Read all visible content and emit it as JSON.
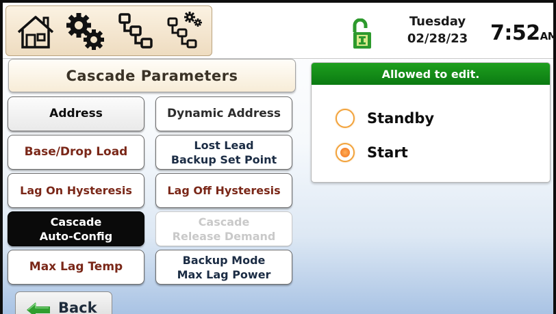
{
  "header": {
    "nav_icons": [
      "home-icon",
      "settings-gears-icon",
      "network-icon",
      "network-settings-icon"
    ],
    "lock_icon": "unlocked-padlock-icon",
    "day": "Tuesday",
    "date": "02/28/23",
    "time": "7:52",
    "ampm": "AM"
  },
  "title": "Cascade Parameters",
  "buttons": {
    "address": "Address",
    "dynamic_address": "Dynamic Address",
    "base_drop_load": "Base/Drop Load",
    "lost_lead_line1": "Lost Lead",
    "lost_lead_line2": "Backup Set Point",
    "lag_on_hysteresis": "Lag On Hysteresis",
    "lag_off_hysteresis": "Lag Off Hysteresis",
    "cascade_auto_line1": "Cascade",
    "cascade_auto_line2": "Auto-Config",
    "cascade_release_line1": "Cascade",
    "cascade_release_line2": "Release Demand",
    "max_lag_temp": "Max Lag Temp",
    "backup_mode_line1": "Backup Mode",
    "backup_mode_line2": "Max Lag Power"
  },
  "edit_panel": {
    "banner": "Allowed to edit.",
    "options": [
      {
        "label": "Standby",
        "selected": false
      },
      {
        "label": "Start",
        "selected": true
      }
    ]
  },
  "back": "Back",
  "colors": {
    "banner_green": "#0b7a12",
    "radio_orange": "#f06f1a",
    "active_button": "#0a0a0a",
    "back_arrow_green": "#2f9e2f"
  }
}
